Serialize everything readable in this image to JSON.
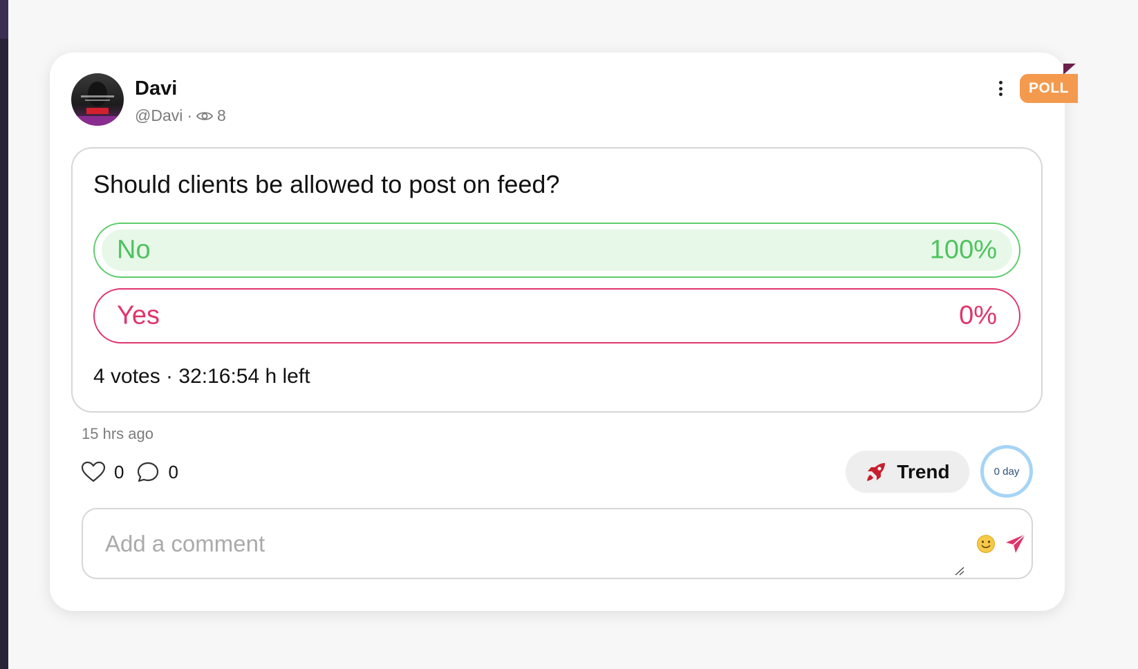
{
  "post": {
    "type_badge": "POLL",
    "author": {
      "name": "Davi",
      "handle": "@Davi",
      "separator": "·",
      "views": "8"
    },
    "time_ago": "15 hrs ago"
  },
  "poll": {
    "question": "Should clients be allowed to post on feed?",
    "options": [
      {
        "label": "No",
        "percent_text": "100%",
        "percent": 100,
        "color": "#4fc25e"
      },
      {
        "label": "Yes",
        "percent_text": "0%",
        "percent": 0,
        "color": "#e0346b"
      }
    ],
    "footer": "4 votes · 32:16:54 h left"
  },
  "actions": {
    "likes": "0",
    "comments": "0",
    "trend_label": "Trend",
    "day_ring": "0 day"
  },
  "comment": {
    "placeholder": "Add a comment"
  },
  "colors": {
    "accent_orange": "#f39a4e",
    "accent_pink": "#e0346b",
    "accent_green": "#4fc25e",
    "ring_blue": "#a6d4f5"
  },
  "icons": [
    "more-vertical-icon",
    "eye-icon",
    "heart-icon",
    "comment-bubble-icon",
    "rocket-icon",
    "emoji-icon",
    "send-icon",
    "resize-handle-icon"
  ]
}
